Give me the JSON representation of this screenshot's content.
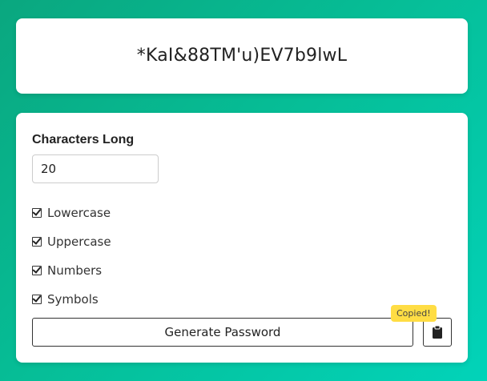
{
  "password": "*KaI&88TM'u)EV7b9lwL",
  "settings": {
    "length_label": "Characters Long",
    "length_value": "20",
    "options": {
      "lowercase": "Lowercase",
      "uppercase": "Uppercase",
      "numbers": "Numbers",
      "symbols": "Symbols"
    },
    "checked": {
      "lowercase": true,
      "uppercase": true,
      "numbers": true,
      "symbols": true
    }
  },
  "actions": {
    "generate_label": "Generate Password",
    "copy_icon": "clipboard-icon",
    "tooltip": "Copied!"
  },
  "colors": {
    "bg_start": "#0aa77f",
    "bg_end": "#02d3b9",
    "tooltip_bg": "#ffdd44"
  }
}
